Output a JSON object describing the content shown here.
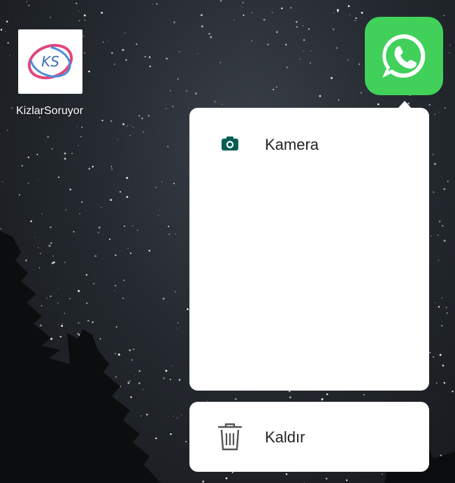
{
  "home_screen": {
    "apps": [
      {
        "label": "KizlarSoruyor",
        "logo_text": "KS",
        "icon": "kizlarsoruyor-logo"
      },
      {
        "label": "",
        "icon": "whatsapp-logo",
        "color": "#41d15b"
      }
    ]
  },
  "context_menu": {
    "shortcuts": [
      {
        "label": "Kamera",
        "icon": "camera-icon",
        "icon_color": "#075e54"
      }
    ],
    "remove": {
      "label": "Kaldır",
      "icon": "trash-icon"
    }
  }
}
